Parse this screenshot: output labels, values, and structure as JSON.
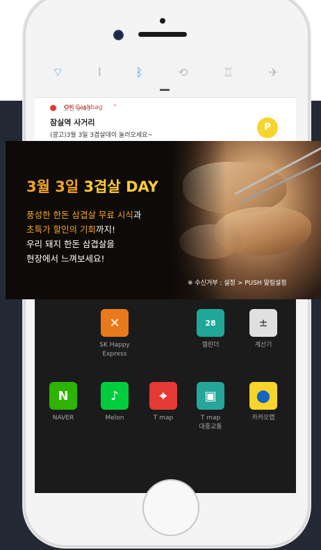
{
  "quick_settings": {
    "icons": [
      "wifi-icon",
      "vibrate-icon",
      "bluetooth-icon",
      "auto-rotate-icon",
      "flashlight-icon",
      "airplane-mode-icon"
    ]
  },
  "notification": {
    "app_name": "OK Cashbag",
    "time": "오전 9:43",
    "title": "잠실역 사거리",
    "body": "(광고)3월 3일 3겹살데이 놀러오세요~",
    "badge": "P"
  },
  "banner": {
    "title_a": "3월 3일 ",
    "title_b": "3겹살 DAY",
    "line1_a": "풍성한 한돈 삼겹살 무료 시식",
    "line1_b": "과",
    "line2_a": "초특가 할인의 기회",
    "line2_b": "까지!",
    "line3": "우리 돼지 한돈 삼겹살을",
    "line4": "현장에서 느껴보세요!",
    "footer": "※ 수신거부 : 설정 > PUSH 알림설정"
  },
  "apps": [
    {
      "label": "SK Happy\nExpress",
      "icon": "sk-happy-express-icon"
    },
    {
      "label": "캘린더",
      "icon": "calendar-icon",
      "day": "28"
    },
    {
      "label": "계산기",
      "icon": "calculator-icon"
    },
    {
      "label": "NAVER",
      "icon": "naver-icon",
      "glyph": "N"
    },
    {
      "label": "Melon",
      "icon": "melon-icon"
    },
    {
      "label": "T map",
      "icon": "tmap-icon"
    },
    {
      "label": "T map\n대중교통",
      "icon": "tmap-transit-icon"
    },
    {
      "label": "카카오맵",
      "icon": "kakaomap-icon"
    }
  ],
  "colors": {
    "accent_orange": "#f5a623",
    "naver_green": "#2db400",
    "background_dark": "#232a35"
  }
}
